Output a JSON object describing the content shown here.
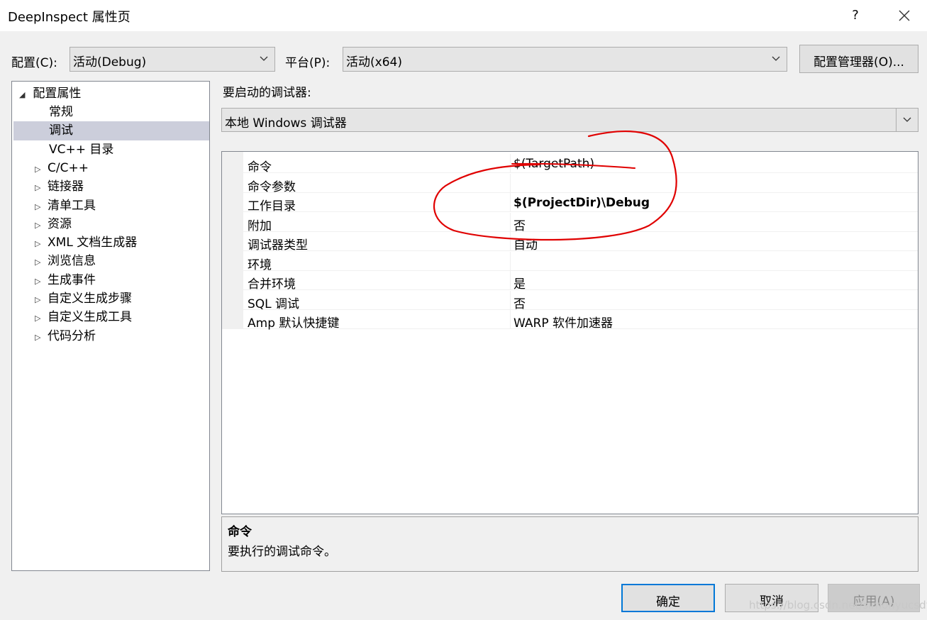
{
  "window": {
    "title": "DeepInspect 属性页",
    "help": "?"
  },
  "toolbar": {
    "config_label": "配置(C):",
    "config_value": "活动(Debug)",
    "platform_label": "平台(P):",
    "platform_value": "活动(x64)",
    "config_manager_button": "配置管理器(O)..."
  },
  "tree": {
    "root": "配置属性",
    "items": [
      {
        "label": "常规",
        "expandable": false
      },
      {
        "label": "调试",
        "expandable": false,
        "selected": true
      },
      {
        "label": "VC++ 目录",
        "expandable": false
      },
      {
        "label": "C/C++",
        "expandable": true
      },
      {
        "label": "链接器",
        "expandable": true
      },
      {
        "label": "清单工具",
        "expandable": true
      },
      {
        "label": "资源",
        "expandable": true
      },
      {
        "label": "XML 文档生成器",
        "expandable": true
      },
      {
        "label": "浏览信息",
        "expandable": true
      },
      {
        "label": "生成事件",
        "expandable": true
      },
      {
        "label": "自定义生成步骤",
        "expandable": true
      },
      {
        "label": "自定义生成工具",
        "expandable": true
      },
      {
        "label": "代码分析",
        "expandable": true
      }
    ],
    "expanded_glyph": "◢",
    "collapsed_glyph": "▷"
  },
  "debugger": {
    "label": "要启动的调试器:",
    "value": "本地 Windows 调试器"
  },
  "properties": [
    {
      "name": "命令",
      "value": "$(TargetPath)",
      "bold": false
    },
    {
      "name": "命令参数",
      "value": "",
      "bold": false
    },
    {
      "name": "工作目录",
      "value": "$(ProjectDir)\\Debug",
      "bold": true
    },
    {
      "name": "附加",
      "value": "否",
      "bold": false
    },
    {
      "name": "调试器类型",
      "value": "自动",
      "bold": false
    },
    {
      "name": "环境",
      "value": "",
      "bold": false
    },
    {
      "name": "合并环境",
      "value": "是",
      "bold": false
    },
    {
      "name": "SQL 调试",
      "value": "否",
      "bold": false
    },
    {
      "name": "Amp 默认快捷键",
      "value": "WARP 软件加速器",
      "bold": false
    }
  ],
  "description": {
    "title": "命令",
    "text": "要执行的调试命令。"
  },
  "buttons": {
    "ok": "确定",
    "cancel": "取消",
    "apply": "应用(A)"
  },
  "watermark": "https://blog.csdn.net/simonyucsdy",
  "colors": {
    "selection": "#cccedb",
    "annotation": "#e00000",
    "ok_border": "#0078d7"
  }
}
